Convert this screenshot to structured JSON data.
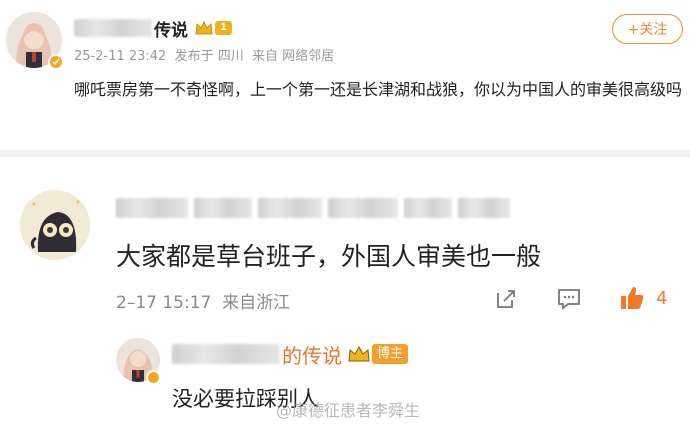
{
  "post": {
    "author_suffix": "传说",
    "level": "1",
    "meta": "25-2-11 23:42  发布于 四川  来自 网络邻居",
    "follow_label": "+关注",
    "content": "哪吒票房第一不奇怪啊，上一个第一还是长津湖和战狼，你以为中国人的审美很高级吗"
  },
  "comment": {
    "text": "大家都是草台班子，外国人审美也一般",
    "meta": "2–17 15:17  来自浙江",
    "like_count": "4"
  },
  "reply": {
    "author_suffix": "的传说",
    "badge": "博主",
    "text": "没必要拉踩别人"
  },
  "watermark": "@康德征患者李舜生",
  "colors": {
    "accent": "#f08a2c",
    "name_orange": "#e8752d",
    "meta_gray": "#999999"
  }
}
